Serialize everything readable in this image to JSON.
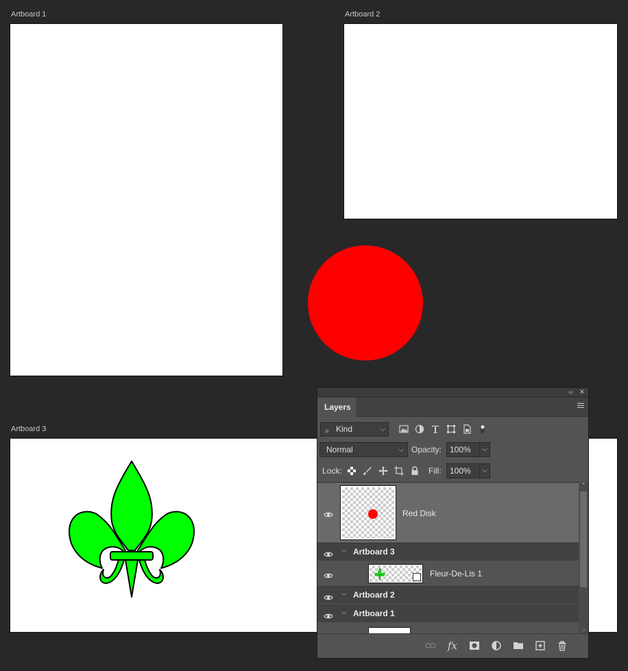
{
  "canvas": {
    "artboards": [
      {
        "label": "Artboard 1"
      },
      {
        "label": "Artboard 2"
      },
      {
        "label": "Artboard 3"
      }
    ],
    "colors": {
      "red_disk": "#ff0000",
      "fleur_fill": "#00ff00",
      "fleur_stroke": "#000000"
    }
  },
  "layers_panel": {
    "tab_label": "Layers",
    "collapse_icon": "double-chevron-left-icon",
    "close_icon": "close-icon",
    "filter": {
      "kind_label": "Kind"
    },
    "blend_mode": "Normal",
    "opacity_label": "Opacity:",
    "opacity_value": "100%",
    "lock_label": "Lock:",
    "fill_label": "Fill:",
    "fill_value": "100%",
    "layers": [
      {
        "name": "Red Disk",
        "type": "layer",
        "selected": true
      },
      {
        "name": "Artboard 3",
        "type": "group"
      },
      {
        "name": "Fleur-De-Lis 1",
        "type": "layer"
      },
      {
        "name": "Artboard 2",
        "type": "group"
      },
      {
        "name": "Artboard 1",
        "type": "group"
      }
    ]
  }
}
